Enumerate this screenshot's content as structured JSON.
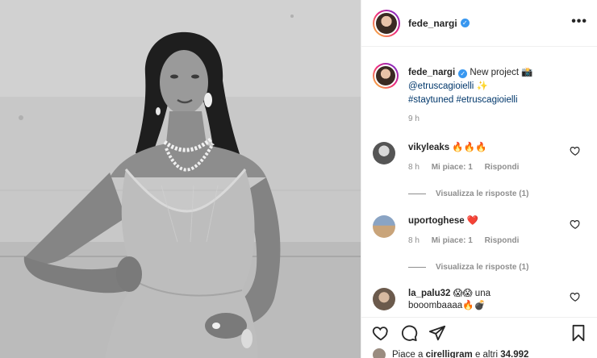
{
  "post": {
    "username": "fede_nargi",
    "verified_mark": "✓",
    "more_label": "•••"
  },
  "caption": {
    "username": "fede_nargi",
    "text": "New project",
    "emoji_1": "📸",
    "mention": "@etruscagioielli",
    "emoji_2": "✨",
    "hashtag_1": "#staytuned",
    "hashtag_2": "#etruscagioielli",
    "time": "9 h"
  },
  "comments": [
    {
      "username": "vikyleaks",
      "text": "🔥🔥🔥",
      "time": "8 h",
      "likes_label": "Mi piace: 1",
      "reply_label": "Rispondi",
      "view_replies": "Visualizza le risposte (1)"
    },
    {
      "username": "uportoghese",
      "text": "❤️",
      "time": "8 h",
      "likes_label": "Mi piace: 1",
      "reply_label": "Rispondi",
      "view_replies": "Visualizza le risposte (1)"
    },
    {
      "username": "la_palu32",
      "text": "😱😱 una booombaaaa🔥💣",
      "time": "",
      "likes_label": "",
      "reply_label": "",
      "view_replies": ""
    }
  ],
  "likes": {
    "prefix": "Piace a",
    "user": "cirelligram",
    "middle": "e altri",
    "count": "34.992"
  },
  "icons": {
    "like": "heart-icon",
    "comment": "comment-icon",
    "share": "share-icon",
    "save": "bookmark-icon",
    "more": "more-dots-icon"
  },
  "colors": {
    "link": "#00376b",
    "verified": "#3897f0",
    "heart_red": "#ed4956",
    "muted": "#8e8e8e"
  }
}
